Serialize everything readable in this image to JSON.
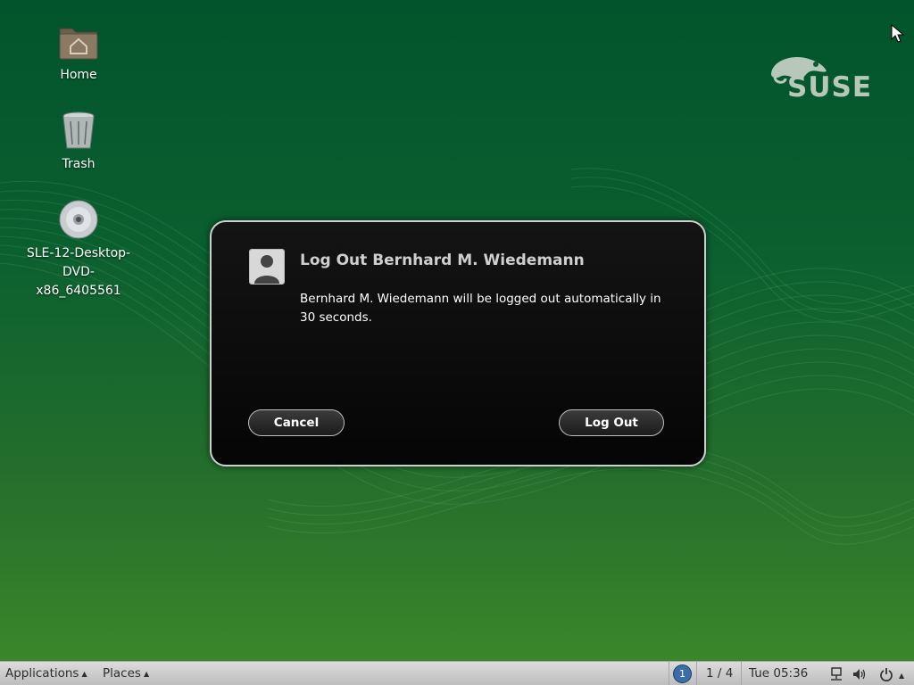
{
  "desktop": {
    "icons": [
      {
        "label": "Home",
        "icon": "home-folder-icon"
      },
      {
        "label": "Trash",
        "icon": "trash-icon"
      },
      {
        "label": "SLE-12-Desktop-DVD-x86_6405561",
        "icon": "dvd-disc-icon"
      }
    ],
    "logo_text": "SUSE"
  },
  "dialog": {
    "title": "Log Out Bernhard M. Wiedemann",
    "message": "Bernhard M. Wiedemann will be logged out automatically in 30 seconds.",
    "cancel_label": "Cancel",
    "logout_label": "Log Out"
  },
  "panel": {
    "applications_label": "Applications",
    "places_label": "Places",
    "workspace_badge": "1",
    "workspace_indicator": "1 / 4",
    "clock": "Tue 05:36"
  },
  "colors": {
    "desktop_top": "#02542c",
    "desktop_bottom": "#3d8a2a",
    "dialog_bg": "#0a0a0a",
    "panel_bg": "#cfcfcf",
    "workspace_badge": "#3b6ea8"
  }
}
